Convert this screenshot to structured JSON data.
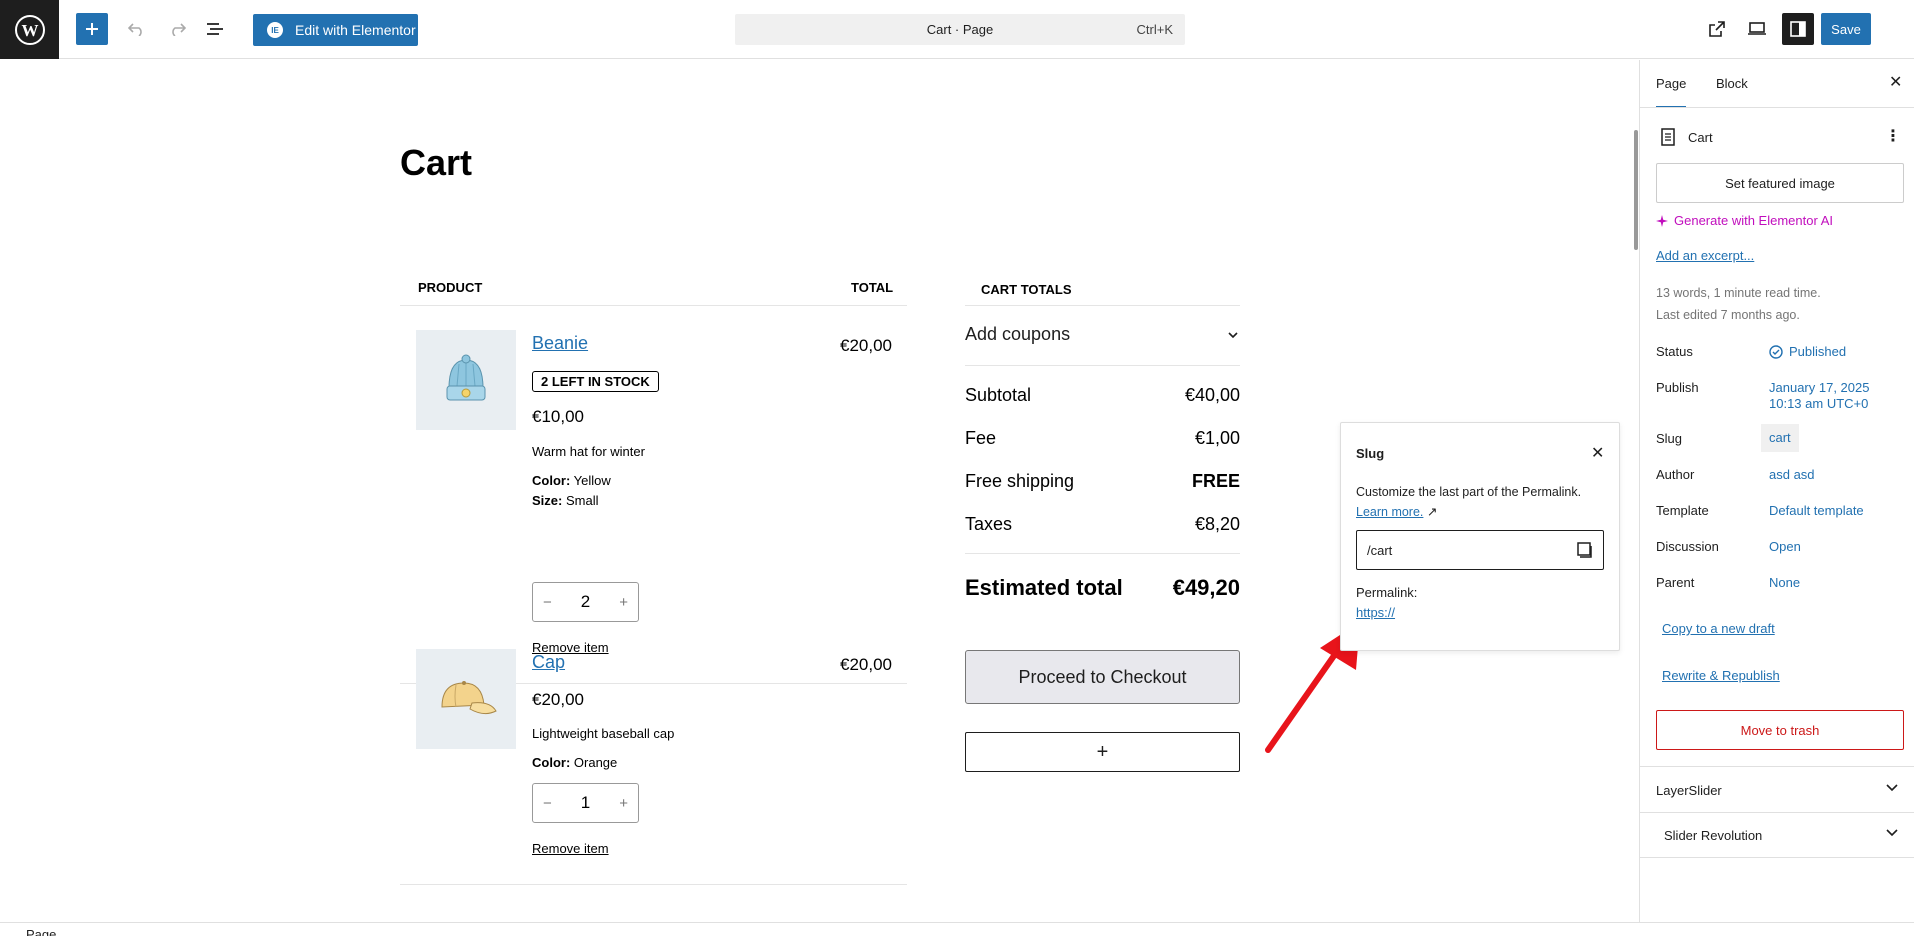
{
  "topbar": {
    "elementor_label": "Edit with Elementor",
    "elementor_icon_text": "IE",
    "command_title": "Cart · Page",
    "command_shortcut": "Ctrl+K",
    "save_label": "Save"
  },
  "page": {
    "title": "Cart",
    "col_product": "Product",
    "col_total": "Total"
  },
  "cart": {
    "items": [
      {
        "name": "Beanie",
        "stock": "2 left in stock",
        "price": "€10,00",
        "description": "Warm hat for winter",
        "attrs": [
          {
            "label": "Color:",
            "value": "Yellow"
          },
          {
            "label": "Size:",
            "value": "Small"
          }
        ],
        "qty": "2",
        "total": "€20,00",
        "remove": "Remove item"
      },
      {
        "name": "Cap",
        "price": "€20,00",
        "description": "Lightweight baseball cap",
        "attrs": [
          {
            "label": "Color:",
            "value": "Orange"
          }
        ],
        "qty": "1",
        "total": "€20,00",
        "remove": "Remove item"
      }
    ],
    "qty_minus": "−",
    "qty_plus": "+"
  },
  "totals": {
    "heading": "Cart totals",
    "coupons": "Add coupons",
    "rows": [
      {
        "label": "Subtotal",
        "value": "€40,00"
      },
      {
        "label": "Fee",
        "value": "€1,00"
      },
      {
        "label": "Free shipping",
        "value": "FREE"
      },
      {
        "label": "Taxes",
        "value": "€8,20"
      }
    ],
    "estimated_label": "Estimated total",
    "estimated_value": "€49,20",
    "checkout": "Proceed to Checkout",
    "add_block": "+"
  },
  "slug_popover": {
    "title": "Slug",
    "help": "Customize the last part of the Permalink.",
    "learn_more": "Learn more.",
    "external_glyph": "↗",
    "slug_value": "/cart",
    "permalink_label": "Permalink:",
    "permalink_url": "https://"
  },
  "sidebar": {
    "tabs": [
      "Page",
      "Block"
    ],
    "doc_title": "Cart",
    "featured_image": "Set featured image",
    "ai_generate": "Generate with Elementor AI",
    "add_excerpt": "Add an excerpt...",
    "meta_words": "13 words, 1 minute read time.",
    "meta_edited": "Last edited 7 months ago.",
    "props": {
      "status_label": "Status",
      "status_value": "Published",
      "publish_label": "Publish",
      "publish_value_line1": "January 17, 2025",
      "publish_value_line2": "10:13 am UTC+0",
      "slug_label": "Slug",
      "slug_value": "cart",
      "author_label": "Author",
      "author_value": "asd asd",
      "template_label": "Template",
      "template_value": "Default template",
      "discussion_label": "Discussion",
      "discussion_value": "Open",
      "parent_label": "Parent",
      "parent_value": "None"
    },
    "copy_draft": "Copy to a new draft",
    "rewrite": "Rewrite & Republish",
    "trash": "Move to trash",
    "panels": [
      "LayerSlider",
      "Slider Revolution"
    ]
  },
  "footer": {
    "breadcrumb": "Page"
  },
  "colors": {
    "accent": "#2271b1",
    "danger": "#cc1818",
    "ai": "#c10ebd",
    "dark": "#1e1e1e",
    "arrow": "#e8141b"
  }
}
